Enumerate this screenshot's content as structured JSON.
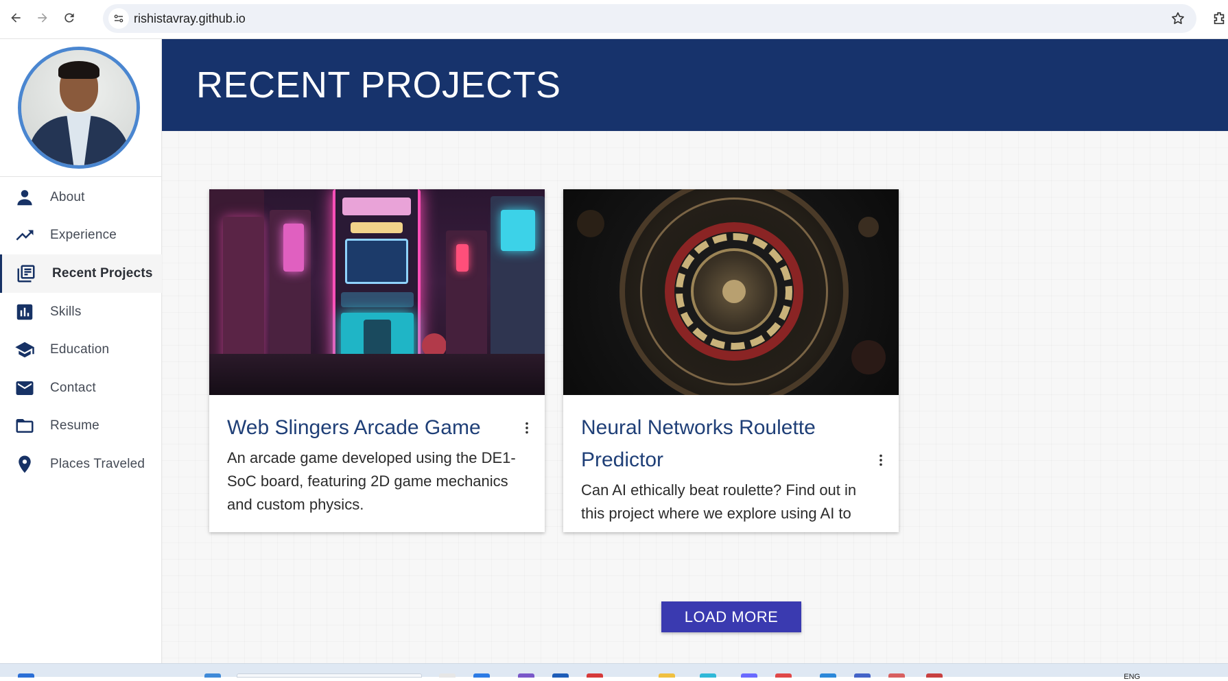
{
  "browser": {
    "url": "rishistavray.github.io"
  },
  "sidebar": {
    "items": [
      {
        "label": "About",
        "icon": "person-icon"
      },
      {
        "label": "Experience",
        "icon": "trending-up-icon"
      },
      {
        "label": "Recent Projects",
        "icon": "library-books-icon",
        "active": true
      },
      {
        "label": "Skills",
        "icon": "bar-chart-icon"
      },
      {
        "label": "Education",
        "icon": "school-icon"
      },
      {
        "label": "Contact",
        "icon": "mail-icon"
      },
      {
        "label": "Resume",
        "icon": "folder-icon"
      },
      {
        "label": "Places Traveled",
        "icon": "location-pin-icon"
      }
    ]
  },
  "header": {
    "title": "RECENT PROJECTS"
  },
  "projects": [
    {
      "title": "Web Slingers Arcade Game",
      "description": "An arcade game developed using the DE1-SoC board, featuring 2D game mechanics and custom physics."
    },
    {
      "title": "Neural Networks Roulette Predictor",
      "description": "Can AI ethically beat roulette? Find out in this project where we explore using AI to"
    }
  ],
  "load_more_label": "LOAD MORE",
  "taskbar": {
    "language": "ENG"
  },
  "colors": {
    "header": "#17336c",
    "accent": "#3a3ab0",
    "nav_icon": "#173265",
    "title_text": "#1f3f77"
  }
}
